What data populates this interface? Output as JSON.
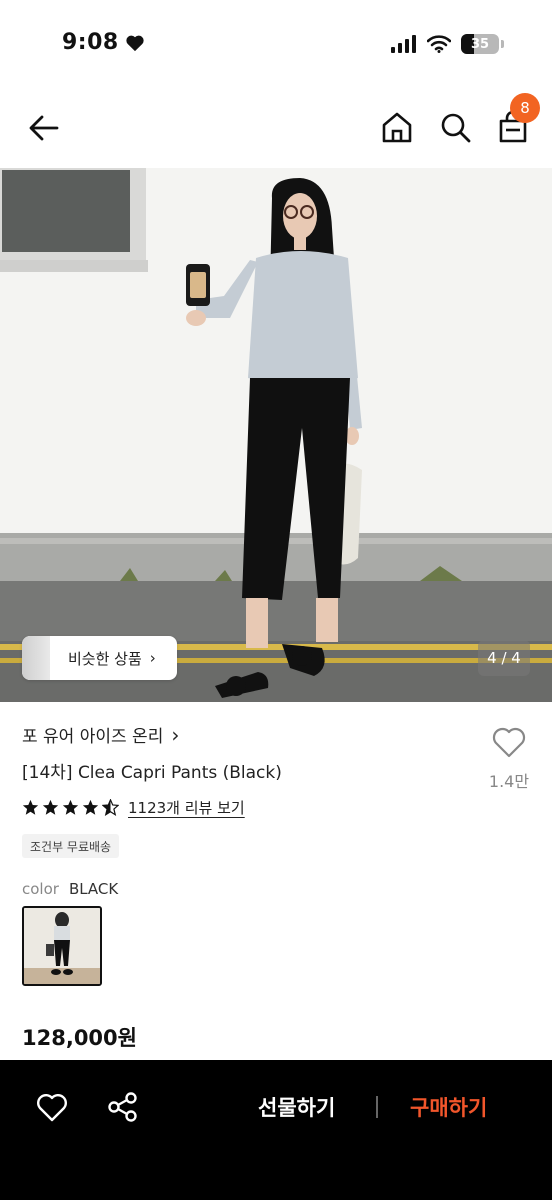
{
  "status_bar": {
    "time": "9:08",
    "battery": "35",
    "battery_level": 0.35
  },
  "nav": {
    "cart_badge": "8",
    "icons": [
      "back-arrow-icon",
      "home-icon",
      "search-icon",
      "cart-icon"
    ]
  },
  "hero": {
    "similar_label": "비슷한 상품",
    "similar_chevron": "›",
    "page_indicator": "4 / 4"
  },
  "product": {
    "brand": "포 유어 아이즈 온리",
    "brand_chevron": "›",
    "title": "[14차] Clea Capri Pants (Black)",
    "wish_count": "1.4만",
    "rating": 4.5,
    "review_text": "1123개 리뷰 보기",
    "shipping_badge": "조건부 무료배송",
    "color_label": "color",
    "color_value": "BLACK",
    "price": "128,000원"
  },
  "bottom_bar": {
    "gift_label": "선물하기",
    "buy_label": "구매하기"
  },
  "colors": {
    "accent_orange": "#f26422",
    "buy_red": "#f2562b",
    "bottom_bar_bg": "#000000"
  }
}
